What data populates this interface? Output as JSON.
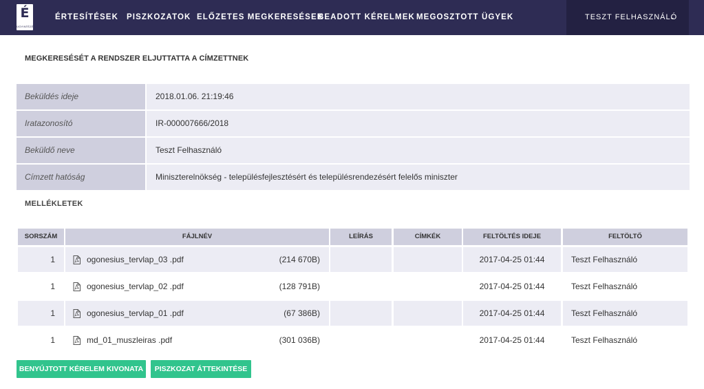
{
  "header": {
    "logo": {
      "letter": "É",
      "sub": "ÜGYINTÉZÉSI"
    },
    "nav": [
      "Értesítések",
      "Piszkozatok",
      "Előzetes megkeresések",
      "Beadott kérelmek",
      "Megosztott ügyek"
    ],
    "user": {
      "name": "Teszt Felhasználó",
      "icon": "chevron-down-icon"
    }
  },
  "status_title": "Megkeresését a rendszer eljuttatta a címzettnek",
  "info": [
    {
      "label": "Beküldés ideje",
      "value": "2018.01.06. 21:19:46"
    },
    {
      "label": "Iratazonosító",
      "value": "IR-000007666/2018"
    },
    {
      "label": "Beküldő neve",
      "value": "Teszt Felhasználó"
    },
    {
      "label": "Címzett hatóság",
      "value": "Miniszterelnökség - településfejlesztésért és településrendezésért felelős miniszter"
    }
  ],
  "attachments": {
    "title": "Mellékletek",
    "columns": [
      "Sorszám",
      "Fájlnév",
      "Leírás",
      "Címkék",
      "Feltöltés ideje",
      "Feltöltő"
    ],
    "rows": [
      {
        "num": "1",
        "file": "ogonesius_tervlap_03 .pdf",
        "size": "(214 670B)",
        "desc": "",
        "tags": "",
        "uploaded": "2017-04-25 01:44",
        "uploader": "Teszt Felhasználó"
      },
      {
        "num": "1",
        "file": "ogonesius_tervlap_02 .pdf",
        "size": "(128 791B)",
        "desc": "",
        "tags": "",
        "uploaded": "2017-04-25 01:44",
        "uploader": "Teszt Felhasználó"
      },
      {
        "num": "1",
        "file": "ogonesius_tervlap_01 .pdf",
        "size": "(67 386B)",
        "desc": "",
        "tags": "",
        "uploaded": "2017-04-25 01:44",
        "uploader": "Teszt Felhasználó"
      },
      {
        "num": "1",
        "file": "md_01_muszleiras .pdf",
        "size": "(301 036B)",
        "desc": "",
        "tags": "",
        "uploaded": "2017-04-25 01:44",
        "uploader": "Teszt Felhasználó"
      }
    ],
    "file_icon": "pdf-file-icon"
  },
  "buttons": {
    "summary": "Benyújtott kérelem kivonata",
    "draft": "Piszkozat áttekintése"
  },
  "colors": {
    "header_bg": "#2e2c54",
    "user_bg": "#232142",
    "label_bg": "#cfcfde",
    "value_bg": "#ececf4",
    "accent": "#31c48d"
  }
}
